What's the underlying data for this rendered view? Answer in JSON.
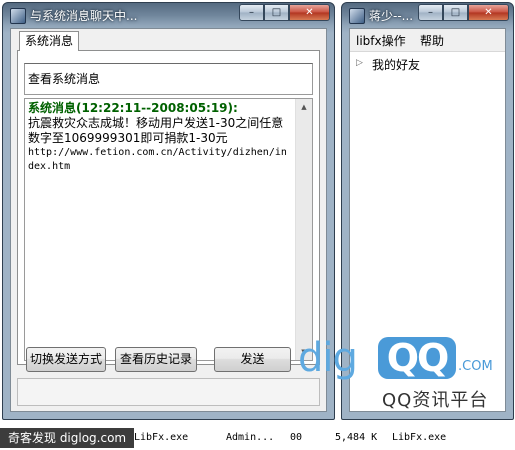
{
  "chat_window": {
    "title": "与系统消息聊天中...",
    "controls": {
      "minimize": "–",
      "maximize": "□",
      "close": "✕"
    },
    "tab_label": "系统消息",
    "info_label": "查看系统消息",
    "message": {
      "header": "系统消息(12:22:11--2008:05:19):",
      "body": "抗震救灾众志成城！移动用户发送1-30之间任意数字至1069999301即可捐款1-30元",
      "url": "http://www.fetion.com.cn/Activity/dizhen/index.htm"
    },
    "buttons": {
      "switch_send": "切换发送方式",
      "history": "查看历史记录",
      "send": "发送"
    },
    "input_value": ""
  },
  "buddy_window": {
    "title": "蒋少--...",
    "controls": {
      "minimize": "–",
      "maximize": "□",
      "close": "✕"
    },
    "menu": {
      "libfx": "libfx操作",
      "help": "帮助"
    },
    "tree": [
      {
        "label": "我的好友",
        "expanded": false
      }
    ]
  },
  "watermark": {
    "dig": "dig",
    "qq": "QQ",
    "dotcom": ".COM",
    "subtitle": "QQ资讯平台"
  },
  "site_badge": "奇客发现 diglog.com",
  "process_row": {
    "image": "LibFx.exe",
    "user": "Admin...",
    "cpu": "00",
    "memory": "5,484 K",
    "description": "LibFx.exe"
  },
  "colors": {
    "header_green": "#006100",
    "watermark_blue": "#4a9ad8"
  }
}
